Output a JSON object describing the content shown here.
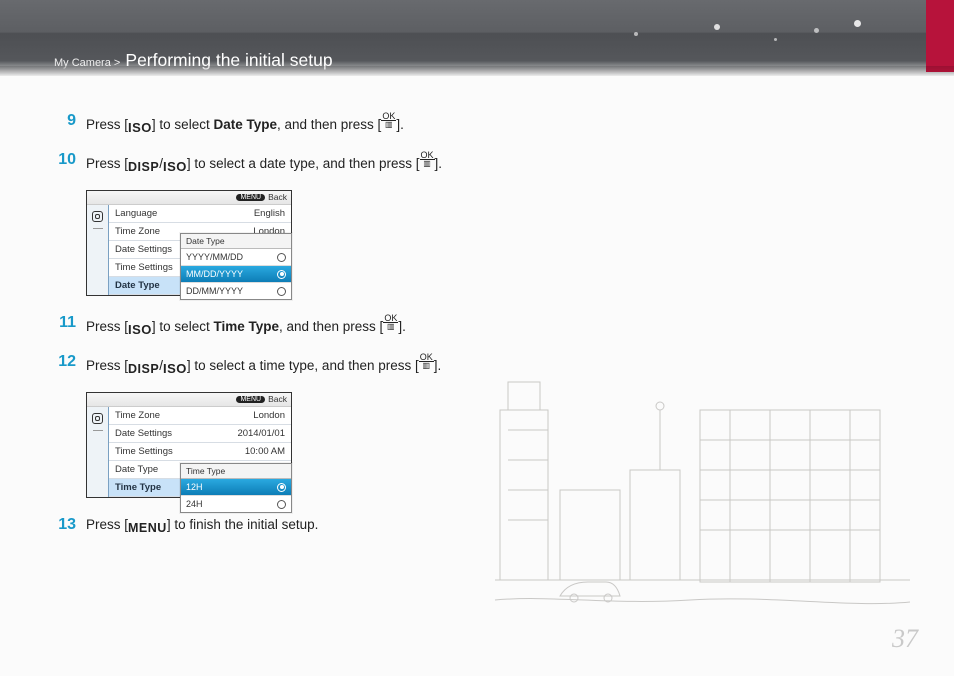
{
  "header": {
    "breadcrumb_prefix": "My Camera >",
    "page_title": "Performing the initial setup"
  },
  "glyphs": {
    "iso": "ISO",
    "disp": "DISP",
    "menu": "MENU",
    "ok_top": "OK",
    "ok_bot": "▥"
  },
  "steps": {
    "s9": {
      "num": "9",
      "pre": "Press [",
      "mid1": "] to select ",
      "bold": "Date Type",
      "mid2": ", and then press [",
      "post": "]."
    },
    "s10": {
      "num": "10",
      "pre": "Press [",
      "sep": "/",
      "mid": "] to select a date type, and then press [",
      "post": "]."
    },
    "s11": {
      "num": "11",
      "pre": "Press [",
      "mid1": "] to select ",
      "bold": "Time Type",
      "mid2": ", and then press [",
      "post": "]."
    },
    "s12": {
      "num": "12",
      "pre": "Press [",
      "sep": "/",
      "mid": "] to select a time type, and then press [",
      "post": "]."
    },
    "s13": {
      "num": "13",
      "pre": "Press [",
      "post": "] to finish the initial setup."
    }
  },
  "menu_common": {
    "back_pill": "MENU",
    "back_label": "Back"
  },
  "menu1": {
    "rows": {
      "language": {
        "label": "Language",
        "value": "English"
      },
      "time_zone": {
        "label": "Time Zone",
        "value": "London"
      },
      "date_settings": {
        "label": "Date Settings",
        "value": ""
      },
      "time_settings": {
        "label": "Time Settings",
        "value": ""
      },
      "date_type": {
        "label": "Date Type",
        "value": ""
      }
    },
    "popup": {
      "header": "Date Type",
      "opts": [
        "YYYY/MM/DD",
        "MM/DD/YYYY",
        "DD/MM/YYYY"
      ],
      "selected_index": 1
    }
  },
  "menu2": {
    "rows": {
      "time_zone": {
        "label": "Time Zone",
        "value": "London"
      },
      "date_settings": {
        "label": "Date Settings",
        "value": "2014/01/01"
      },
      "time_settings": {
        "label": "Time Settings",
        "value": "10:00 AM"
      },
      "date_type": {
        "label": "Date Type",
        "value": ""
      },
      "time_type": {
        "label": "Time Type",
        "value": ""
      }
    },
    "popup": {
      "header": "Time Type",
      "opts": [
        "12H",
        "24H"
      ],
      "selected_index": 0
    }
  },
  "page_number": "37"
}
